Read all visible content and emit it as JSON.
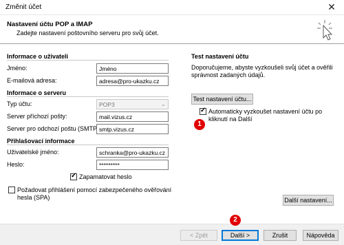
{
  "window": {
    "title": "Změnit účet",
    "close_glyph": "✕"
  },
  "header": {
    "title": "Nastavení účtu POP a IMAP",
    "subtitle": "Zadejte nastavení poštovního serveru pro svůj účet.",
    "icon": "cursor-click-icon"
  },
  "user_info": {
    "section_title": "Informace o uživateli",
    "name_label": "Jméno:",
    "name_value": "Jméno",
    "email_label": "E-mailová adresa:",
    "email_value": "adresa@pro-ukazku.cz"
  },
  "server_info": {
    "section_title": "Informace o serveru",
    "type_label": "Typ účtu:",
    "type_value": "POP3",
    "incoming_label": "Server příchozí pošty:",
    "incoming_value": "mail.vizus.cz",
    "outgoing_label": "Server pro odchozí poštu (SMTP):",
    "outgoing_value": "smtp.vizus.cz"
  },
  "login_info": {
    "section_title": "Přihlašovací informace",
    "username_label": "Uživatelské jméno:",
    "username_value": "schranka@pro-ukazku.cz",
    "password_label": "Heslo:",
    "password_value": "*********",
    "remember_label": "Zapamatovat heslo",
    "remember_checked": true,
    "spa_label_line1": "Požadovat přihlášení pomocí zabezpečeného ověřování",
    "spa_label_line2": "hesla (SPA)",
    "spa_checked": false
  },
  "test": {
    "section_title": "Test nastavení účtu",
    "description_line1": "Doporučujeme, abyste vyzkoušeli svůj účet a ověřili",
    "description_line2": "správnost zadaných údajů.",
    "test_button": "Test nastavení účtu...",
    "auto_test_line1": "Automaticky vyzkoušet nastavení účtu po",
    "auto_test_line2": "kliknutí na Další",
    "auto_test_checked": true
  },
  "more_settings_button": "Další nastavení...",
  "footer": {
    "back": "< Zpět",
    "next": "Další >",
    "cancel": "Zrušit",
    "help": "Nápověda"
  },
  "annotations": {
    "badge1": "1",
    "badge2": "2",
    "color": "#e00000"
  }
}
